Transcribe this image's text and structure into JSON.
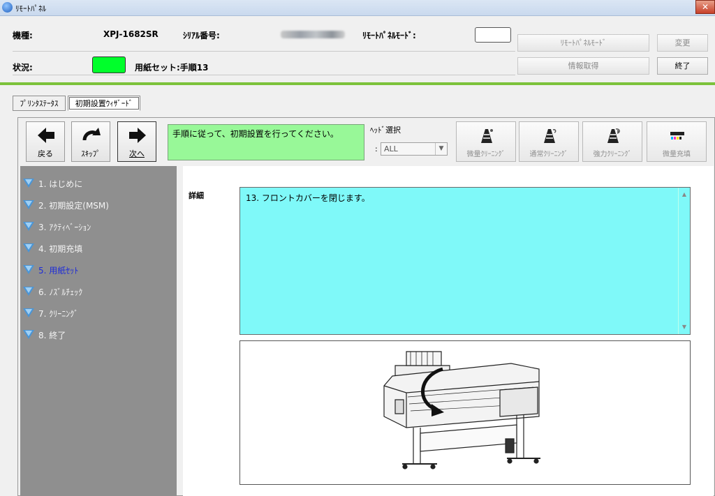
{
  "window": {
    "title": "ﾘﾓｰﾄﾊﾟﾈﾙ",
    "close_label": "✕"
  },
  "header": {
    "model_label": "機種:",
    "model_value": "XPJ-1682SR",
    "serial_label": "ｼﾘｱﾙ番号:",
    "remote_mode_label": "ﾘﾓｰﾄﾊﾟﾈﾙﾓｰﾄﾞ:",
    "status_label": "状況:",
    "status_text": "用紙セット:手順13",
    "status_color": "#00ff2b"
  },
  "buttons": {
    "remote_mode": "ﾘﾓｰﾄﾊﾟﾈﾙﾓｰﾄﾞ",
    "change": "変更",
    "get_info": "情報取得",
    "exit": "終了"
  },
  "tabs": [
    {
      "label": "ﾌﾟﾘﾝﾀｽﾃｰﾀｽ"
    },
    {
      "label": "初期設置ｳｨｻﾞｰﾄﾞ",
      "active": true
    }
  ],
  "wizard": {
    "back_label": "戻る",
    "skip_label": "ｽｷｯﾌﾟ",
    "next_label": "次へ",
    "message": "手順に従って、初期設置を行ってください。",
    "head_select_label": "ﾍｯﾄﾞ選択",
    "head_select_value": "ALL",
    "tools": [
      {
        "label": "微量ｸﾘｰﾆﾝｸﾞ",
        "icon": "head-cleaning-light-icon"
      },
      {
        "label": "通常ｸﾘｰﾆﾝｸﾞ",
        "icon": "head-cleaning-normal-icon"
      },
      {
        "label": "強力ｸﾘｰﾆﾝｸﾞ",
        "icon": "head-cleaning-strong-icon"
      },
      {
        "label": "微量充填",
        "icon": "ink-fill-icon"
      }
    ]
  },
  "steps": [
    {
      "label": "1. はじめに"
    },
    {
      "label": "2. 初期設定(MSM)"
    },
    {
      "label": "3. ｱｸﾃｨﾍﾞｰｼｮﾝ"
    },
    {
      "label": "4. 初期充填"
    },
    {
      "label": "5. 用紙ｾｯﾄ",
      "current": true
    },
    {
      "label": "6. ﾉｽﾞﾙﾁｪｯｸ"
    },
    {
      "label": "7. ｸﾘｰﾆﾝｸﾞ"
    },
    {
      "label": "8. 終了"
    }
  ],
  "detail": {
    "label": "詳細",
    "text": "13. フロントカバーを閉じます。"
  },
  "colors": {
    "accent_line": "#7cc23b",
    "message_bg": "#98f898",
    "detail_bg": "#7ff9f9",
    "current_step": "#1e2cd8"
  }
}
